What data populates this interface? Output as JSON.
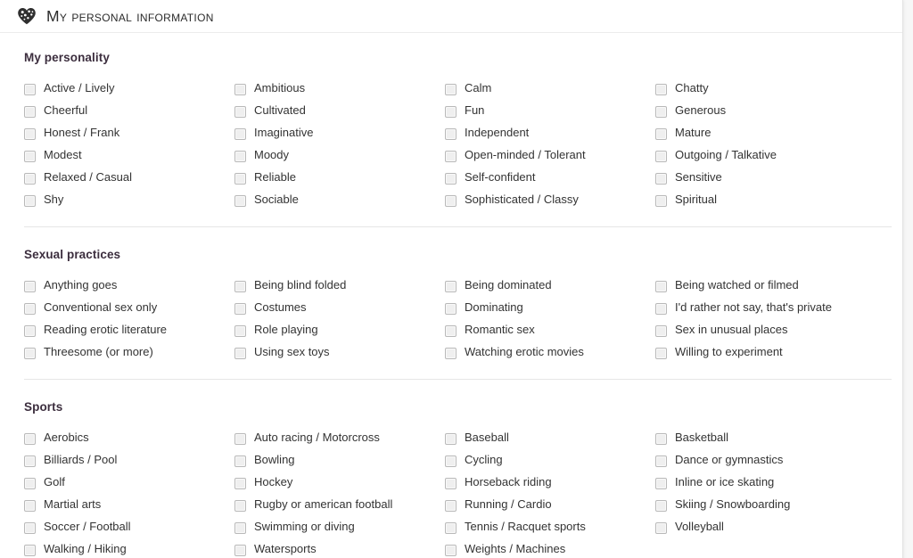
{
  "header": {
    "icon": "heart-icon",
    "title": "My personal information"
  },
  "sections": [
    {
      "id": "personality",
      "title": "My personality",
      "options": [
        "Active / Lively",
        "Ambitious",
        "Calm",
        "Chatty",
        "Cheerful",
        "Cultivated",
        "Fun",
        "Generous",
        "Honest / Frank",
        "Imaginative",
        "Independent",
        "Mature",
        "Modest",
        "Moody",
        "Open-minded / Tolerant",
        "Outgoing / Talkative",
        "Relaxed / Casual",
        "Reliable",
        "Self-confident",
        "Sensitive",
        "Shy",
        "Sociable",
        "Sophisticated / Classy",
        "Spiritual"
      ]
    },
    {
      "id": "sexual-practices",
      "title": "Sexual practices",
      "options": [
        "Anything goes",
        "Being blind folded",
        "Being dominated",
        "Being watched or filmed",
        "Conventional sex only",
        "Costumes",
        "Dominating",
        "I'd rather not say, that's private",
        "Reading erotic literature",
        "Role playing",
        "Romantic sex",
        "Sex in unusual places",
        "Threesome (or more)",
        "Using sex toys",
        "Watching erotic movies",
        "Willing to experiment"
      ]
    },
    {
      "id": "sports",
      "title": "Sports",
      "options": [
        "Aerobics",
        "Auto racing / Motorcross",
        "Baseball",
        "Basketball",
        "Billiards / Pool",
        "Bowling",
        "Cycling",
        "Dance or gymnastics",
        "Golf",
        "Hockey",
        "Horseback riding",
        "Inline or ice skating",
        "Martial arts",
        "Rugby or american football",
        "Running / Cardio",
        "Skiing / Snowboarding",
        "Soccer / Football",
        "Swimming or diving",
        "Tennis / Racquet sports",
        "Volleyball",
        "Walking / Hiking",
        "Watersports",
        "Weights / Machines"
      ]
    }
  ],
  "colors": {
    "heading": "#3c2e3e",
    "text": "#333333",
    "divider": "#e6e6e6",
    "checkbox_fill": "#efefef",
    "checkbox_border": "#b9b9b9",
    "page_background": "#ffffff"
  }
}
